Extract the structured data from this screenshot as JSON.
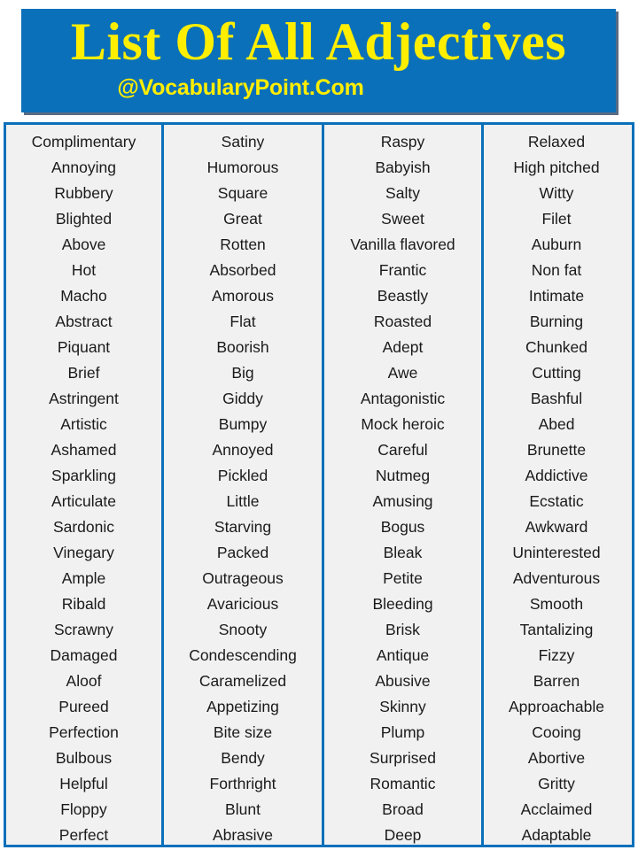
{
  "header": {
    "title": "List Of All Adjectives",
    "subtitle": "@VocabularyPoint.Com",
    "banner_color": "#0b70ba",
    "text_color": "#ffee00"
  },
  "table": {
    "border_color": "#0b70ba",
    "background_color": "#f1f1f1",
    "text_color": "#1a1a1a",
    "column_count": 4,
    "row_count": 28,
    "columns": [
      {
        "index": 1,
        "words": [
          "Complimentary",
          "Annoying",
          "Rubbery",
          "Blighted",
          "Above",
          "Hot",
          "Macho",
          "Abstract",
          "Piquant",
          "Brief",
          "Astringent",
          "Artistic",
          "Ashamed",
          "Sparkling",
          "Articulate",
          "Sardonic",
          "Vinegary",
          "Ample",
          "Ribald",
          "Scrawny",
          "Damaged",
          "Aloof",
          "Pureed",
          "Perfection",
          "Bulbous",
          "Helpful",
          "Floppy",
          "Perfect"
        ]
      },
      {
        "index": 2,
        "words": [
          "Satiny",
          "Humorous",
          "Square",
          "Great",
          "Rotten",
          "Absorbed",
          "Amorous",
          "Flat",
          "Boorish",
          "Big",
          "Giddy",
          "Bumpy",
          "Annoyed",
          "Pickled",
          "Little",
          "Starving",
          "Packed",
          "Outrageous",
          "Avaricious",
          "Snooty",
          "Condescending",
          "Caramelized",
          "Appetizing",
          "Bite size",
          "Bendy",
          "Forthright",
          "Blunt",
          "Abrasive"
        ]
      },
      {
        "index": 3,
        "words": [
          "Raspy",
          "Babyish",
          "Salty",
          "Sweet",
          "Vanilla flavored",
          "Frantic",
          "Beastly",
          "Roasted",
          "Adept",
          "Awe",
          "Antagonistic",
          "Mock heroic",
          "Careful",
          "Nutmeg",
          "Amusing",
          "Bogus",
          "Bleak",
          "Petite",
          "Bleeding",
          "Brisk",
          "Antique",
          "Abusive",
          "Skinny",
          "Plump",
          "Surprised",
          "Romantic",
          "Broad",
          "Deep"
        ]
      },
      {
        "index": 4,
        "words": [
          "Relaxed",
          "High pitched",
          "Witty",
          "Filet",
          "Auburn",
          "Non fat",
          "Intimate",
          "Burning",
          "Chunked",
          "Cutting",
          "Bashful",
          "Abed",
          "Brunette",
          "Addictive",
          "Ecstatic",
          "Awkward",
          "Uninterested",
          "Adventurous",
          "Smooth",
          "Tantalizing",
          "Fizzy",
          "Barren",
          "Approachable",
          "Cooing",
          "Abortive",
          "Gritty",
          "Acclaimed",
          "Adaptable"
        ]
      }
    ]
  }
}
